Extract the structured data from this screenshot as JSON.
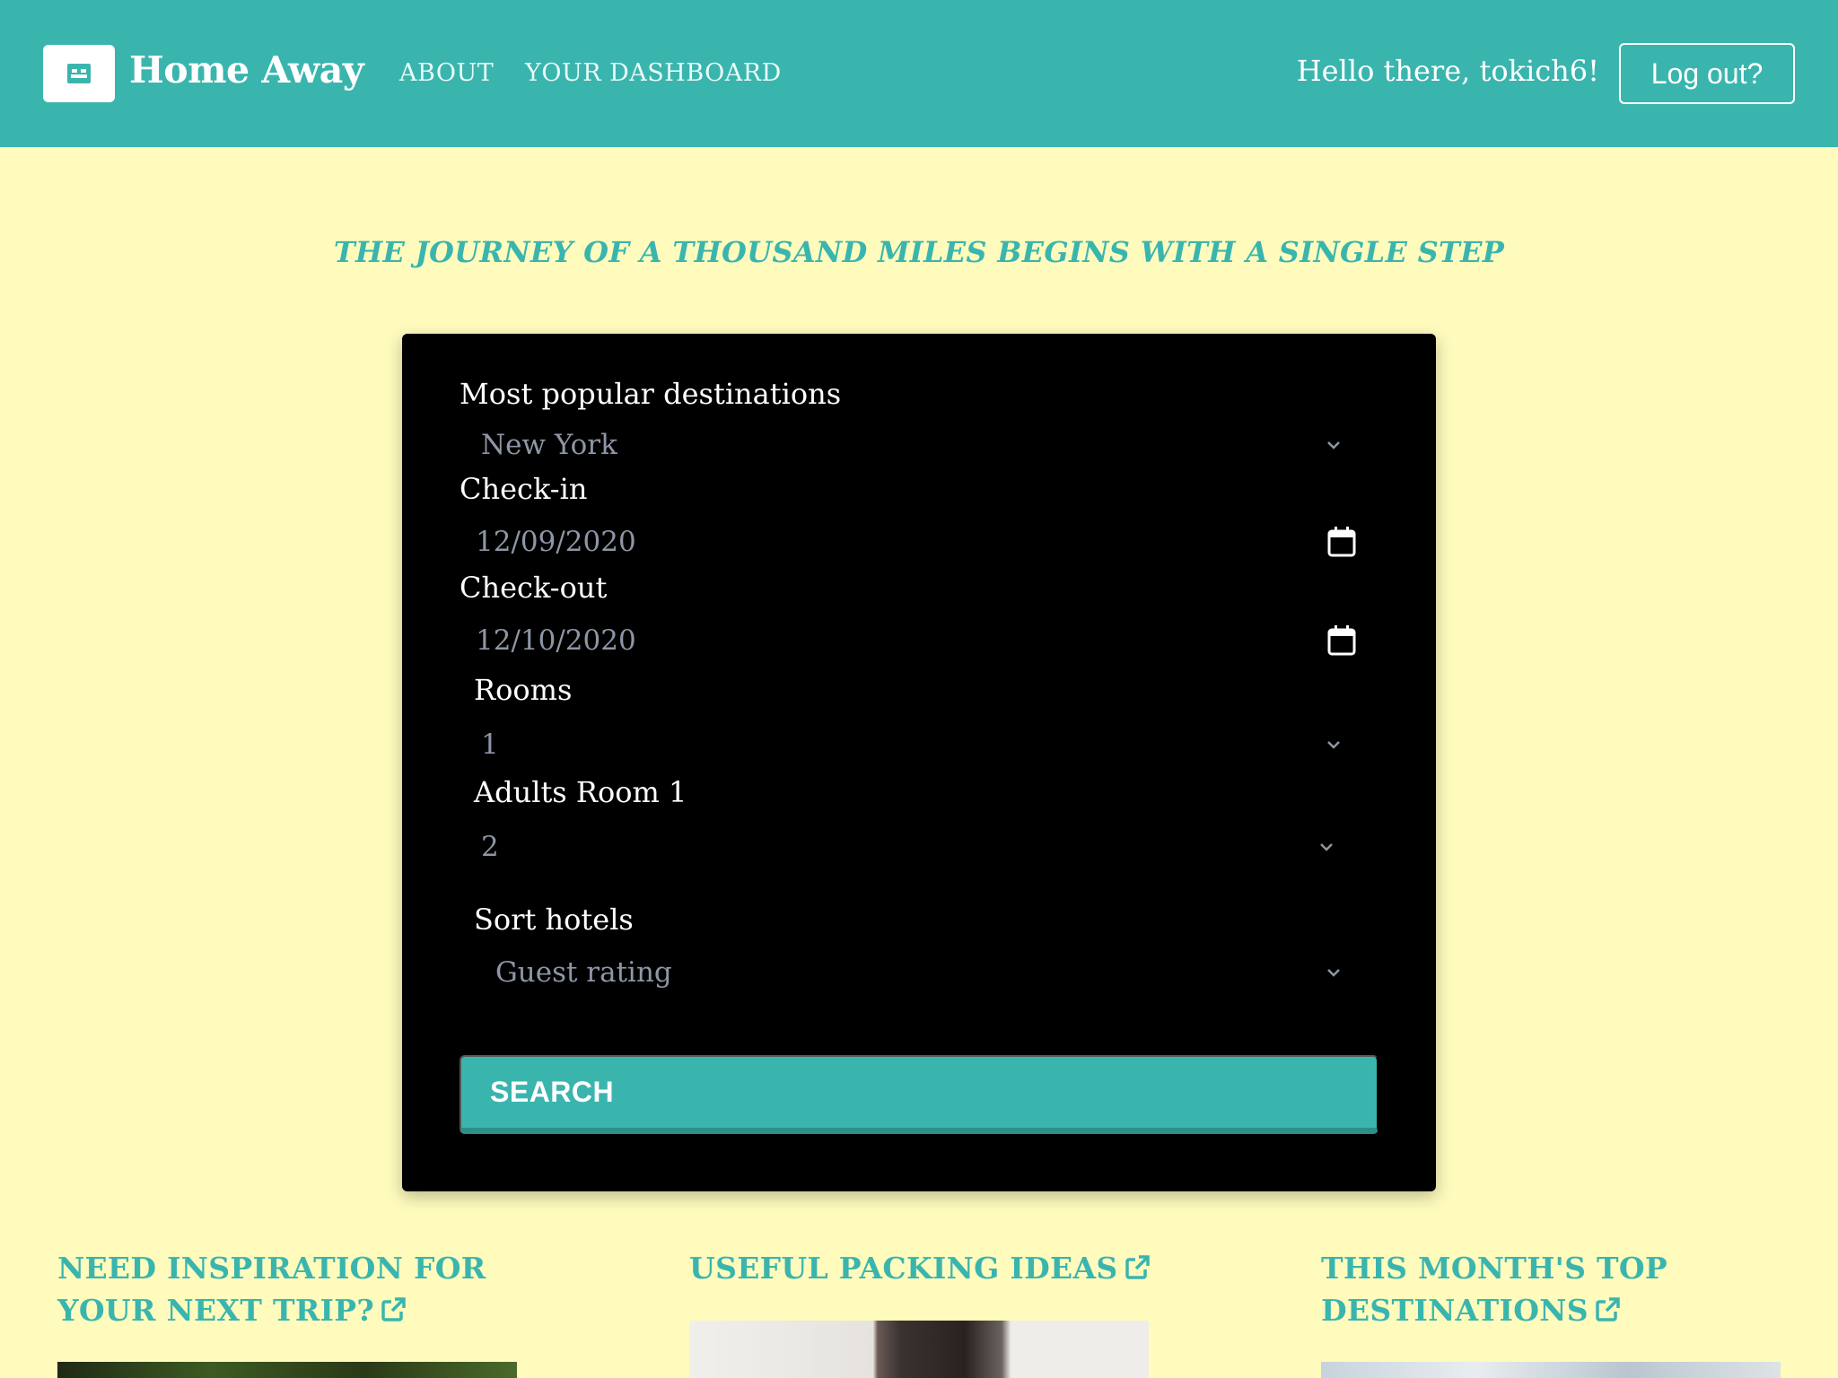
{
  "header": {
    "brand": "Home Away",
    "nav": [
      "ABOUT",
      "YOUR DASHBOARD"
    ],
    "greeting": "Hello there, tokich6!",
    "logout_label": "Log out?",
    "logo_icon": "bed-icon"
  },
  "quote": "THE JOURNEY OF A THOUSAND MILES BEGINS WITH A SINGLE STEP",
  "form": {
    "destination_label": "Most popular destinations",
    "destination_value": "New York",
    "checkin_label": "Check-in",
    "checkin_value": "12/09/2020",
    "checkout_label": "Check-out",
    "checkout_value": "12/10/2020",
    "rooms_label": "Rooms",
    "rooms_value": "1",
    "adults_label": "Adults Room 1",
    "adults_value": "2",
    "sort_label": "Sort hotels",
    "sort_value": "Guest rating",
    "search_label": "SEARCH"
  },
  "columns": [
    {
      "title_line1": "NEED INSPIRATION FOR",
      "title_line2": "YOUR NEXT TRIP?"
    },
    {
      "title_line1": "USEFUL PACKING IDEAS"
    },
    {
      "title_line1": "THIS MONTH'S TOP",
      "title_line2": "DESTINATIONS"
    }
  ],
  "colors": {
    "accent": "#3ab5ae",
    "background": "#fefbbd",
    "card": "#000000"
  }
}
